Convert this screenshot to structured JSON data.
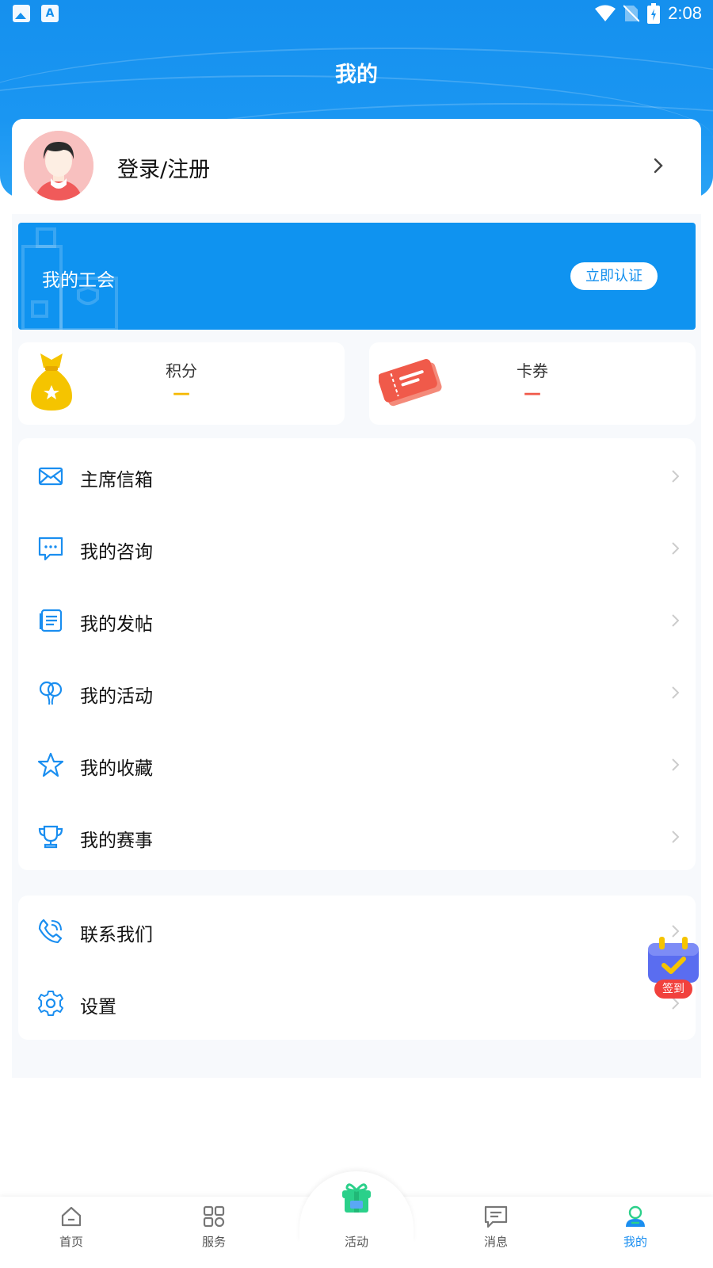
{
  "status_bar": {
    "time": "2:08"
  },
  "header": {
    "title": "我的"
  },
  "profile": {
    "login_label": "登录/注册"
  },
  "union": {
    "label": "我的工会",
    "verify_button": "立即认证"
  },
  "stats": {
    "points": {
      "title": "积分",
      "value": "—",
      "color": "#f5b800"
    },
    "coupons": {
      "title": "卡券",
      "value": "—",
      "color": "#f05a4a"
    }
  },
  "menu": {
    "items": [
      {
        "label": "主席信箱",
        "icon": "mail-icon"
      },
      {
        "label": "我的咨询",
        "icon": "chat-icon"
      },
      {
        "label": "我的发帖",
        "icon": "post-icon"
      },
      {
        "label": "我的活动",
        "icon": "balloon-icon"
      },
      {
        "label": "我的收藏",
        "icon": "star-icon"
      },
      {
        "label": "我的赛事",
        "icon": "trophy-icon"
      }
    ],
    "extra_items": [
      {
        "label": "联系我们",
        "icon": "phone-icon"
      },
      {
        "label": "设置",
        "icon": "gear-icon"
      }
    ]
  },
  "signin": {
    "label": "签到"
  },
  "tabbar": {
    "tabs": [
      {
        "label": "首页",
        "icon": "home-icon"
      },
      {
        "label": "服务",
        "icon": "grid-icon"
      },
      {
        "label": "活动",
        "icon": "gift-icon"
      },
      {
        "label": "消息",
        "icon": "message-icon"
      },
      {
        "label": "我的",
        "icon": "user-icon"
      }
    ],
    "active_index": 4
  },
  "colors": {
    "primary": "#1590ee",
    "active_tab": "#1a8ef0",
    "tab_inactive": "#555555"
  }
}
